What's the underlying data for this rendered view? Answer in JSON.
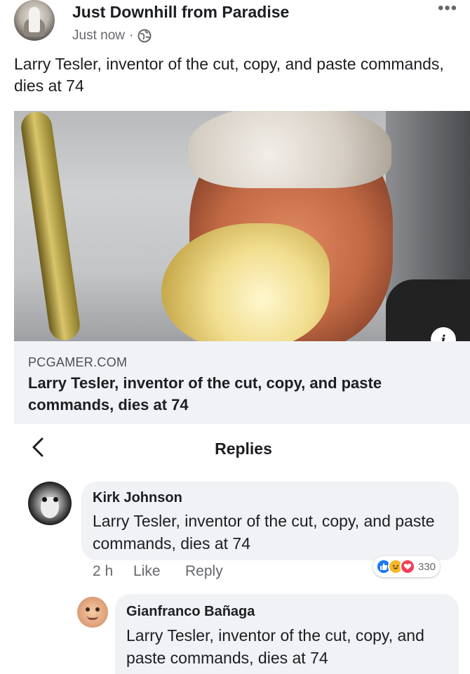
{
  "post": {
    "page_name": "Just Downhill from Paradise",
    "timestamp": "Just now",
    "separator": "·",
    "audience_icon": "globe-icon",
    "more_icon": "•••",
    "text": "Larry Tesler, inventor of the cut, copy, and paste commands, dies at 74"
  },
  "link": {
    "info_icon": "i",
    "domain": "PCGAMER.COM",
    "title": "Larry Tesler, inventor of the cut, copy, and paste commands, dies at 74"
  },
  "replies": {
    "title": "Replies",
    "back_icon": "chevron-left-icon",
    "comments": [
      {
        "name": "Kirk Johnson",
        "text": "Larry Tesler, inventor of the cut, copy, and paste commands, dies at 74",
        "time": "2 h",
        "like_label": "Like",
        "reply_label": "Reply",
        "reactions": [
          "like",
          "haha",
          "love"
        ],
        "reaction_count": "330"
      },
      {
        "name": "Gianfranco Bañaga",
        "text": "Larry Tesler, inventor of the cut, copy, and paste commands, dies at 74"
      }
    ]
  },
  "colors": {
    "secondary_text": "#65676b",
    "bubble_bg": "#f0f2f5",
    "like_blue": "#1877f2",
    "haha_yellow": "#f7b928",
    "love_red": "#f33e58"
  }
}
